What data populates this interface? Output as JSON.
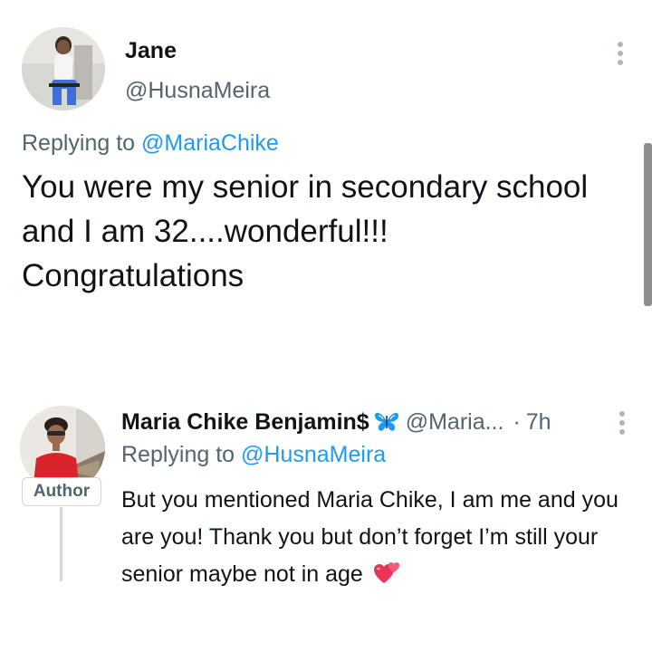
{
  "tweet": {
    "author_name": "Jane",
    "author_handle": "@HusnaMeira",
    "replying_prefix": "Replying to ",
    "replying_handle": "@MariaChike",
    "text": "You were my senior in secondary school and I am 32....wonderful!!! Congratulations"
  },
  "reply": {
    "author_name": "Maria Chike Benjamin$",
    "author_handle": "@Maria...",
    "separator": "·",
    "time": "7h",
    "badge": "Author",
    "replying_prefix": "Replying to ",
    "replying_handle": "@HusnaMeira",
    "text": "But you mentioned Maria Chike, I am me and you are you! Thank you but don’t forget I’m still your senior maybe not in age"
  },
  "icons": {
    "more_menu": "more-vertical-icon",
    "butterfly": "butterfly-icon",
    "heart": "two-hearts-icon"
  },
  "colors": {
    "link": "#1d9bf0",
    "secondary_text": "#536471",
    "primary_text": "#0f1419",
    "butterfly": "#1d9bf0",
    "heart": "#e8355a"
  }
}
